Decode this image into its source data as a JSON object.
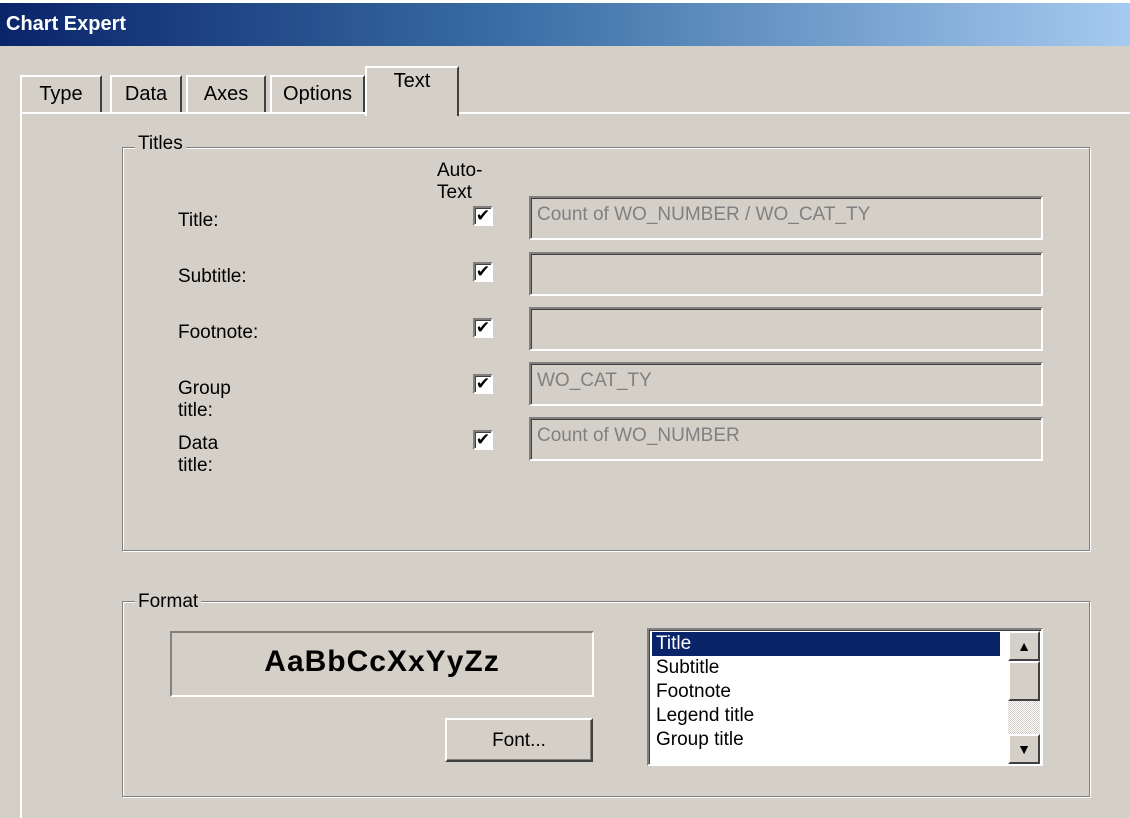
{
  "window": {
    "title": "Chart Expert"
  },
  "tabs": [
    "Type",
    "Data",
    "Axes",
    "Options",
    "Text"
  ],
  "active_tab": "Text",
  "titles": {
    "group_label": "Titles",
    "auto_text_header": "Auto-Text",
    "rows": [
      {
        "label": "Title:",
        "checked": true,
        "check_mark": "✔",
        "value": "Count of WO_NUMBER / WO_CAT_TY"
      },
      {
        "label": "Subtitle:",
        "checked": true,
        "check_mark": "✔",
        "value": ""
      },
      {
        "label": "Footnote:",
        "checked": true,
        "check_mark": "✔",
        "value": ""
      },
      {
        "label": "Group title:",
        "checked": true,
        "check_mark": "✔",
        "value": "WO_CAT_TY"
      },
      {
        "label": "Data title:",
        "checked": true,
        "check_mark": "✔",
        "value": "Count of WO_NUMBER"
      }
    ]
  },
  "format": {
    "group_label": "Format",
    "sample_text": "AaBbCcXxYyZz",
    "font_button": "Font...",
    "list_items": [
      "Title",
      "Subtitle",
      "Footnote",
      "Legend title",
      "Group title"
    ],
    "selected_item": "Title",
    "scroll_up_glyph": "▲",
    "scroll_down_glyph": "▼"
  },
  "colors": {
    "titlebar_start": "#0a246a",
    "titlebar_end": "#a6caf0",
    "dialog_bg": "#d4d0c8",
    "selection_bg": "#0a246a",
    "disabled_text": "#808080"
  }
}
